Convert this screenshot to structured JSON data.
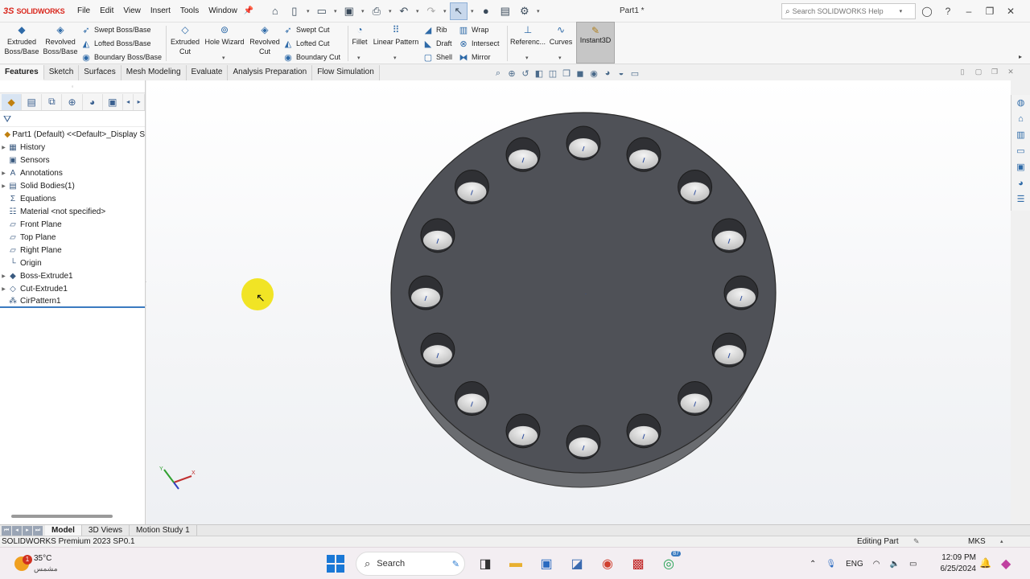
{
  "app": {
    "logo_mark": "3S",
    "logo_text": "SOLIDWORKS",
    "document_title": "Part1 *",
    "menus": [
      "File",
      "Edit",
      "View",
      "Insert",
      "Tools",
      "Window"
    ],
    "search_placeholder": "Search SOLIDWORKS Help"
  },
  "commands": {
    "extruded_boss": "Extruded Boss/Base",
    "revolved_boss": "Revolved Boss/Base",
    "swept_boss": "Swept Boss/Base",
    "lofted_boss": "Lofted Boss/Base",
    "boundary_boss": "Boundary Boss/Base",
    "extruded_cut": "Extruded Cut",
    "hole_wizard": "Hole Wizard",
    "revolved_cut": "Revolved Cut",
    "swept_cut": "Swept Cut",
    "lofted_cut": "Lofted Cut",
    "boundary_cut": "Boundary Cut",
    "fillet": "Fillet",
    "linear_pattern": "Linear Pattern",
    "rib": "Rib",
    "draft": "Draft",
    "shell": "Shell",
    "wrap": "Wrap",
    "intersect": "Intersect",
    "mirror": "Mirror",
    "reference": "Referenc...",
    "curves": "Curves",
    "instant3d": "Instant3D"
  },
  "tabs": [
    "Features",
    "Sketch",
    "Surfaces",
    "Mesh Modeling",
    "Evaluate",
    "Analysis Preparation",
    "Flow Simulation"
  ],
  "tree": [
    {
      "label": "Part1 (Default) <<Default>_Display S",
      "icon": "part-icon"
    },
    {
      "label": "History",
      "icon": "history-icon"
    },
    {
      "label": "Sensors",
      "icon": "sensor-icon"
    },
    {
      "label": "Annotations",
      "icon": "annotation-icon"
    },
    {
      "label": "Solid Bodies(1)",
      "icon": "solid-bodies-icon"
    },
    {
      "label": "Equations",
      "icon": "equations-icon"
    },
    {
      "label": "Material <not specified>",
      "icon": "material-icon"
    },
    {
      "label": "Front Plane",
      "icon": "plane-icon"
    },
    {
      "label": "Top Plane",
      "icon": "plane-icon"
    },
    {
      "label": "Right Plane",
      "icon": "plane-icon"
    },
    {
      "label": "Origin",
      "icon": "origin-icon"
    },
    {
      "label": "Boss-Extrude1",
      "icon": "extrude-icon"
    },
    {
      "label": "Cut-Extrude1",
      "icon": "cut-extrude-icon"
    },
    {
      "label": "CirPattern1",
      "icon": "circular-pattern-icon"
    }
  ],
  "model": {
    "hole_count": 16
  },
  "triad": {
    "x": "X",
    "y": "Y"
  },
  "bottom_tabs": [
    "Model",
    "3D Views",
    "Motion Study 1"
  ],
  "status": {
    "product": "SOLIDWORKS Premium 2023 SP0.1",
    "mode": "Editing Part",
    "units": "MKS"
  },
  "taskbar": {
    "weather_badge": "1",
    "temperature": "35°C",
    "condition": "مشمس",
    "search": "Search",
    "whatsapp_badge": "87",
    "language": "ENG",
    "time": "12:09 PM",
    "date": "6/25/2024"
  }
}
